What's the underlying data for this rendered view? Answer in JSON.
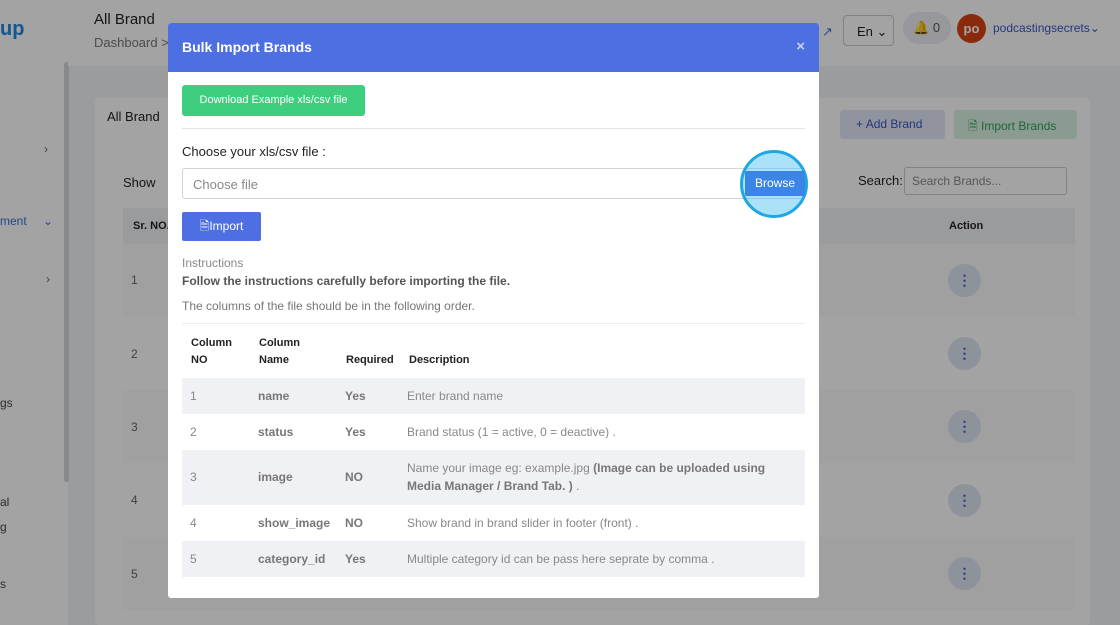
{
  "background": {
    "logo_text": "up",
    "page_title": "All Brand",
    "breadcrumb": "Dashboard >",
    "sidebar": {
      "management_label": "ment",
      "settings_label": "gs",
      "portal_label": "al",
      "g_label": "g",
      "s_label": "s"
    },
    "topbar": {
      "language": "En",
      "notification_count": "0",
      "avatar_initials": "po",
      "username": "podcastingsecrets"
    },
    "card": {
      "title": "All Brand",
      "add_brand_label": "Add Brand",
      "import_brands_label": "Import Brands",
      "show_label": "Show",
      "search_label": "Search:",
      "search_placeholder": "Search Brands...",
      "col_sr": "Sr. NO.",
      "col_action": "Action",
      "row_numbers": [
        "1",
        "2",
        "3",
        "4",
        "5"
      ]
    }
  },
  "modal": {
    "title": "Bulk Import Brands",
    "close_symbol": "×",
    "download_label": "Download Example xls/csv file",
    "choose_label": "Choose your xls/csv file :",
    "file_placeholder": "Choose file",
    "browse_label": "Browse",
    "import_label": "Import",
    "instructions_title": "Instructions",
    "instructions_note": "Follow the instructions carefully before importing the file.",
    "instructions_order": "The columns of the file should be in the following order.",
    "table": {
      "headers": {
        "col_no_1": "Column",
        "col_no_2": "NO",
        "col_name_1": "Column",
        "col_name_2": "Name",
        "required": "Required",
        "description": "Description"
      },
      "rows": [
        {
          "no": "1",
          "name": "name",
          "required": "Yes",
          "desc": "Enter brand name"
        },
        {
          "no": "2",
          "name": "status",
          "required": "Yes",
          "desc": "Brand status (1 = active, 0 = deactive) ."
        },
        {
          "no": "3",
          "name": "image",
          "required": "NO",
          "desc_plain": "Name your image eg: example.jpg",
          "desc_bold": "(Image can be uploaded using Media Manager / Brand Tab. )",
          "desc_tail": "."
        },
        {
          "no": "4",
          "name": "show_image",
          "required": "NO",
          "desc": "Show brand in brand slider in footer (front) ."
        },
        {
          "no": "5",
          "name": "category_id",
          "required": "Yes",
          "desc": "Multiple category id can be pass here seprate by comma ."
        }
      ]
    }
  },
  "colors": {
    "primary": "#4e6fe2",
    "success": "#3ecf7e",
    "browse": "#3a85e6",
    "highlight": "#1fa7e3"
  }
}
